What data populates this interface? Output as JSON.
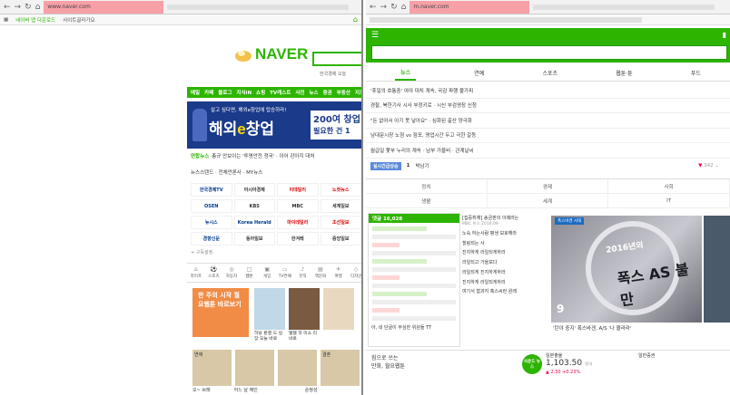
{
  "left": {
    "url": "www.naver.com",
    "bookmarks": [
      "네이버 앱 다운로드",
      "사이트골라가요"
    ],
    "logo": "NAVER",
    "search_hint": "한국경제 오늘",
    "gnb": [
      "메일",
      "카페",
      "블로그",
      "지식iN",
      "쇼핑",
      "TV캐스트",
      "사전",
      "뉴스",
      "증권",
      "부동산",
      "지도"
    ],
    "banner": {
      "top": "살고 싶다면, 해외e창업에 탑승하라!",
      "main1": "해외",
      "main_e": "e",
      "main2": "창업",
      "right1": "200여 창업자",
      "right2": "필요한 건 1"
    },
    "news_label": "연합뉴스",
    "news_text": "총규 안보이는 '투명안전 정국' · 이어 강아지 대처",
    "newsstand": "뉴스스탠드 · 전체언론사 · MY뉴스",
    "press": [
      {
        "name": "한국경제TV",
        "cls": "b"
      },
      {
        "name": "아시아경제",
        "cls": ""
      },
      {
        "name": "이데일리",
        "cls": "r"
      },
      {
        "name": "노컷뉴스",
        "cls": "r"
      },
      {
        "name": "OSEN",
        "cls": "b"
      },
      {
        "name": "KBS",
        "cls": ""
      },
      {
        "name": "MBC",
        "cls": ""
      },
      {
        "name": "세계일보",
        "cls": ""
      },
      {
        "name": "뉴시스",
        "cls": "b"
      },
      {
        "name": "Korea Herald",
        "cls": "b"
      },
      {
        "name": "마이데일리",
        "cls": "r"
      },
      {
        "name": "조선일보",
        "cls": "r"
      },
      {
        "name": "경향신문",
        "cls": "b"
      },
      {
        "name": "동아일보",
        "cls": ""
      },
      {
        "name": "한겨레",
        "cls": ""
      },
      {
        "name": "중앙일보",
        "cls": ""
      }
    ],
    "gubok": "+ 구독설정",
    "tabs": [
      {
        "label": "라이프",
        "icon": "⌂"
      },
      {
        "label": "스포츠",
        "icon": "⚽"
      },
      {
        "label": "자동차",
        "icon": "◎"
      },
      {
        "label": "웹툰",
        "icon": "□"
      },
      {
        "label": "게임",
        "icon": "▣"
      },
      {
        "label": "TV연예",
        "icon": "▭"
      },
      {
        "label": "뮤직",
        "icon": "♪"
      },
      {
        "label": "책문화",
        "icon": "▤"
      },
      {
        "label": "여행",
        "icon": "✈"
      },
      {
        "label": "디자인",
        "icon": "◇"
      }
    ],
    "orange_text": "한 주의 시작 월요웹툰 바로보기",
    "cards": [
      {
        "title": "허당 판결 드 실장 오늘 바로",
        "sub": "",
        "color": "#c0d8e8"
      },
      {
        "title": "웹웹 하 미소 리 바로",
        "sub": "",
        "color": "#7a5a40"
      },
      {
        "title": "",
        "sub": "",
        "color": "#e8d8c0"
      }
    ],
    "cards2": [
      "연애",
      "",
      "",
      "결혼"
    ],
    "bottom": [
      "오~ 브래",
      "어느 날 애인",
      "",
      "순정성"
    ]
  },
  "right": {
    "url": "m.naver.com",
    "tabs": [
      "뉴스",
      "연예",
      "스포츠",
      "웹툰·툰",
      "푸드"
    ],
    "news": [
      "'휴일의 호통중' 여야 대치 계속, 국감 파행 불가피",
      "경찰, 북한기사 시사 부정키로 · 시신 부검영장 신청",
      "\"돈 없어서 아기 못 낳아요\" · 심화된 출산 양극화",
      "남대문시장 노점 vs 점포, 영업시간 두고 극한 갈등",
      "월급일 쫓부 누리의 계속 · 남부 가을비 · 관계날씨"
    ],
    "realtime_badge": "실시간급상승",
    "realtime_rank": "1",
    "realtime_word": "박남기",
    "realtime_count": "342",
    "cats": [
      "정치",
      "경제",
      "사회",
      "생활",
      "세계",
      "IT"
    ],
    "comment_header": "댓글 16,028",
    "comment_line": "아, 네 단골이 무심한 위원들 TT",
    "list": [
      {
        "t": "[집중취재] 송금판의 이때라는",
        "s": "MBC 뉴스 2016.09"
      },
      {
        "t": "노숙 하는사람 평생 보호해라",
        "s": ""
      },
      {
        "t": "힐링되는 사",
        "s": ""
      },
      {
        "t": "진지하게 라일되게하라",
        "s": ""
      },
      {
        "t": "라일되고 가을보다",
        "s": ""
      },
      {
        "t": "라일되게 진지하게하라",
        "s": ""
      },
      {
        "t": "진지하게 라일되게하라",
        "s": ""
      },
      {
        "t": "여기서 혐과지 혹스씨런 원래",
        "s": ""
      }
    ],
    "photo_tag": "폭스바겐 사태",
    "photo_year": "2016년의",
    "photo_main": "폭스 AS 불만",
    "photo_num": "9",
    "photo_caption": "'탄야 중지' 폭스바겐, A/S '나 몰라라'",
    "ad_left1": "힘으로 쓰는",
    "ad_left2": "만화, 월요웹툰",
    "ad_logo": "사운드 뉴스",
    "quote_label": "일본출율",
    "quote_value": "1,103.50",
    "quote_unit": "원/$",
    "quote_delta": "▲ 2.50 +0.23%",
    "quote_label2": "일반증권"
  }
}
